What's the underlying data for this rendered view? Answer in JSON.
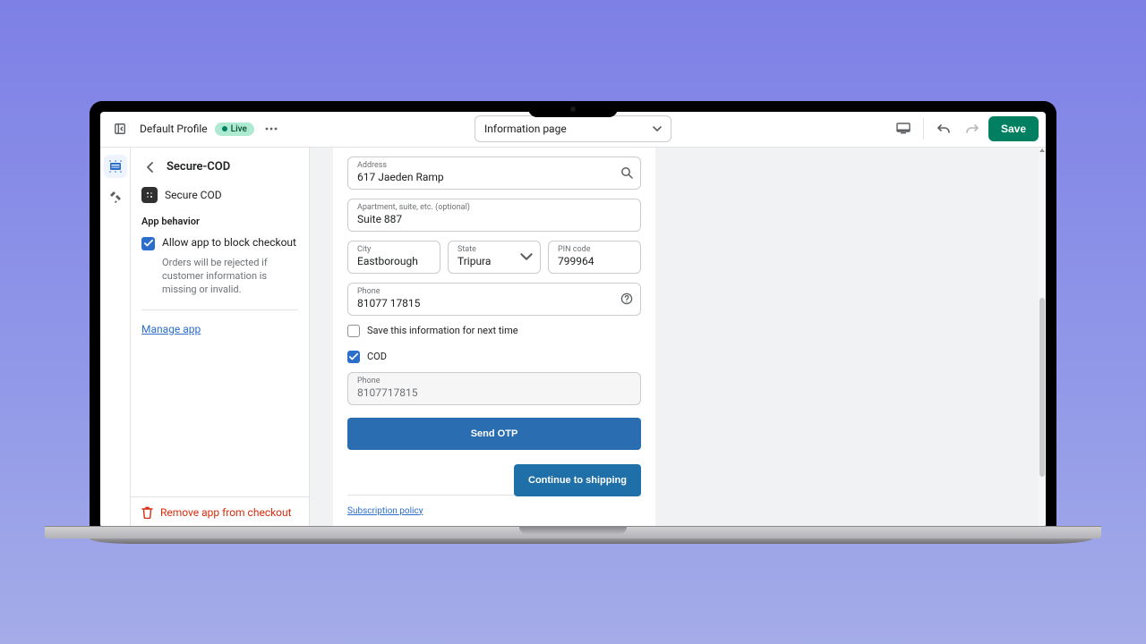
{
  "topbar": {
    "profile_label": "Default Profile",
    "live_badge": "Live",
    "page_select": "Information page",
    "save_label": "Save"
  },
  "sidebar": {
    "title": "Secure-COD",
    "app_name": "Secure COD",
    "section_title": "App behavior",
    "block_checkout_label": "Allow app to block checkout",
    "block_checkout_desc": "Orders will be rejected if customer information is missing or invalid.",
    "manage_app_label": "Manage app",
    "remove_label": "Remove app from checkout"
  },
  "form": {
    "address_label": "Address",
    "address_value": "617 Jaeden Ramp",
    "apt_label": "Apartment, suite, etc. (optional)",
    "apt_value": "Suite 887",
    "city_label": "City",
    "city_value": "Eastborough",
    "state_label": "State",
    "state_value": "Tripura",
    "pin_label": "PIN code",
    "pin_value": "799964",
    "phone_label": "Phone",
    "phone_value": "81077 17815",
    "save_info_label": "Save this information for next time",
    "cod_label": "COD",
    "cod_phone_label": "Phone",
    "cod_phone_value": "8107717815",
    "send_otp_label": "Send OTP",
    "continue_label": "Continue to shipping",
    "policy_label": "Subscription policy"
  }
}
